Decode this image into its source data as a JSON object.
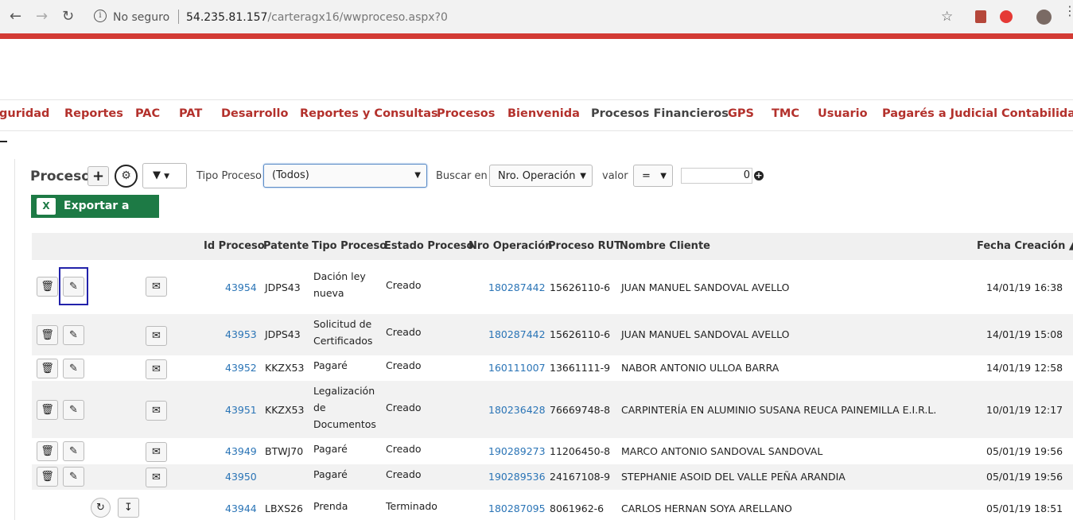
{
  "browser": {
    "security_text": "No seguro",
    "url_host": "54.235.81.157",
    "url_path": "/carteragx16/wwproceso.aspx?0"
  },
  "nav": {
    "items": [
      "guridad",
      "Reportes",
      "PAC",
      "PAT",
      "Desarrollo",
      "Reportes y Consultas",
      "Procesos",
      "Bienvenida",
      "Procesos Financieros",
      "GPS",
      "TMC",
      "Usuario",
      "Pagarés a Judicial",
      "Contabilidad"
    ]
  },
  "toolbar": {
    "title": "Proceso",
    "add_label": "+",
    "tipo_label": "Tipo Proceso",
    "tipo_value": "(Todos)",
    "buscar_label": "Buscar en",
    "buscar_value": "Nro. Operación",
    "valor_label": "valor",
    "operator_value": "=",
    "value_input": "0",
    "export_label": "Exportar a Excel"
  },
  "table": {
    "headers": {
      "id": "Id Proceso",
      "patente": "Patente",
      "tipo": "Tipo Proceso",
      "estado": "Estado Proceso",
      "nro": "Nro Operación",
      "rut": "Proceso RUT",
      "nombre": "Nombre Cliente",
      "fecha": "Fecha Creación ▲"
    },
    "rows": [
      {
        "id": "43954",
        "patente": "JDPS43",
        "tipo": "Dación ley nueva",
        "estado": "Creado",
        "nro": "180287442",
        "rut": "15626110-6",
        "nombre": "JUAN MANUEL SANDOVAL AVELLO",
        "fecha": "14/01/19 16:38"
      },
      {
        "id": "43953",
        "patente": "JDPS43",
        "tipo": "Solicitud de Certificados",
        "estado": "Creado",
        "nro": "180287442",
        "rut": "15626110-6",
        "nombre": "JUAN MANUEL SANDOVAL AVELLO",
        "fecha": "14/01/19 15:08"
      },
      {
        "id": "43952",
        "patente": "KKZX53",
        "tipo": "Pagaré",
        "estado": "Creado",
        "nro": "160111007",
        "rut": "13661111-9",
        "nombre": "NABOR ANTONIO ULLOA BARRA",
        "fecha": "14/01/19 12:58"
      },
      {
        "id": "43951",
        "patente": "KKZX53",
        "tipo": "Legalización de Documentos",
        "estado": "Creado",
        "nro": "180236428",
        "rut": "76669748-8",
        "nombre": "CARPINTERÍA EN ALUMINIO SUSANA REUCA PAINEMILLA E.I.R.L.",
        "fecha": "10/01/19 12:17"
      },
      {
        "id": "43949",
        "patente": "BTWJ70",
        "tipo": "Pagaré",
        "estado": "Creado",
        "nro": "190289273",
        "rut": "11206450-8",
        "nombre": "MARCO ANTONIO SANDOVAL SANDOVAL",
        "fecha": "05/01/19 19:56"
      },
      {
        "id": "43950",
        "patente": "",
        "tipo": "Pagaré",
        "estado": "Creado",
        "nro": "190289536",
        "rut": "24167108-9",
        "nombre": "STEPHANIE ASOID DEL VALLE PEÑA ARANDIA",
        "fecha": "05/01/19 19:56"
      },
      {
        "id": "43944",
        "patente": "LBXS26",
        "tipo": "Prenda",
        "estado": "Terminado",
        "nro": "180287095",
        "rut": "8061962-6",
        "nombre": "CARLOS HERNAN SOYA ARELLANO",
        "fecha": "05/01/19 18:51"
      }
    ]
  }
}
